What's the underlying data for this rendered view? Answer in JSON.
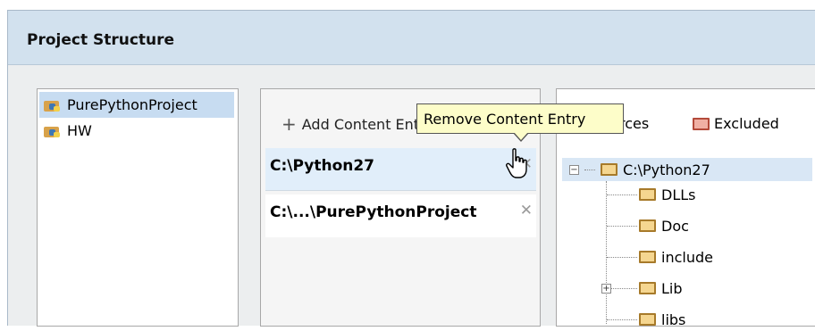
{
  "dialog": {
    "title": "Project Structure"
  },
  "modules": [
    {
      "label": "PurePythonProject",
      "selected": true
    },
    {
      "label": "HW",
      "selected": false
    }
  ],
  "content": {
    "add_label": "Add Content Entry",
    "entries": [
      {
        "path": "C:\\Python27"
      },
      {
        "path": "C:\\...\\PurePythonProject"
      }
    ],
    "remove_icon": "close-icon"
  },
  "tooltip": {
    "text": "Remove Content Entry"
  },
  "tree": {
    "header": {
      "sources_label": "rces",
      "excluded_label": "Excluded"
    },
    "root": "C:\\Python27",
    "children": [
      {
        "label": "DLLs",
        "expandable": false
      },
      {
        "label": "Doc",
        "expandable": false
      },
      {
        "label": "include",
        "expandable": false
      },
      {
        "label": "Lib",
        "expandable": true
      },
      {
        "label": "libs",
        "expandable": false
      }
    ]
  },
  "colors": {
    "selection": "#c7dcf1",
    "tooltip_bg": "#fdfdc9",
    "titlebar": "#d2e1ee"
  }
}
